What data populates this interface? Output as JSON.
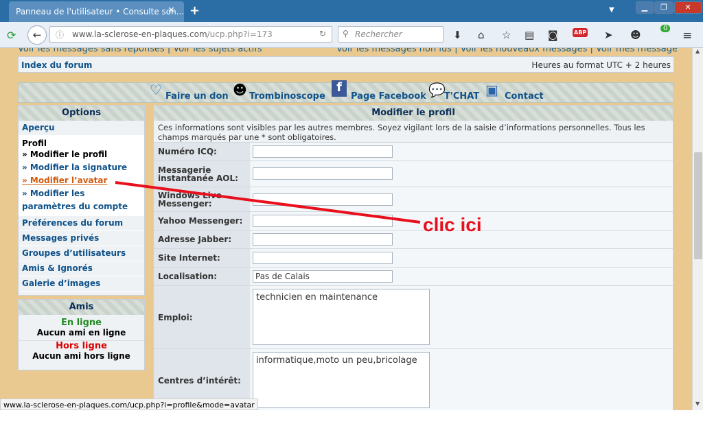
{
  "browser": {
    "tab_title": "Panneau de l'utilisateur • Consulte son...",
    "url_host": "www.la-sclerose-en-plaques.com",
    "url_path": "/ucp.php?i=173",
    "search_placeholder": "Rechercher",
    "abp_label": "ABP",
    "badge_count": "0",
    "status_url": "www.la-sclerose-en-plaques.com/ucp.php?i=profile&mode=avatar"
  },
  "forum": {
    "top_links_left": "Voir les messages sans réponses | Voir les sujets actifs",
    "top_links_right": "Voir les messages non lus | Voir les nouveaux messages | Voir mes messages",
    "index_link": "Index du forum",
    "timezone": "Heures au format UTC + 2 heures",
    "icon_links": [
      "Faire un don",
      "Trombinoscope",
      "Page Facebook",
      "T'CHAT",
      "Contact"
    ]
  },
  "sidebar": {
    "options_title": "Options",
    "apercu": "Aperçu",
    "profil_title": "Profil",
    "profil_items": [
      "» Modifier le profil",
      "» Modifier la signature",
      "» Modifier l’avatar",
      "» Modifier les paramètres du compte"
    ],
    "items": [
      "Préférences du forum",
      "Messages privés",
      "Groupes d’utilisateurs",
      "Amis & Ignorés",
      "Galerie d’images"
    ],
    "amis_title": "Amis",
    "online_label": "En ligne",
    "online_none": "Aucun ami en ligne",
    "offline_label": "Hors ligne",
    "offline_none": "Aucun ami hors ligne"
  },
  "form": {
    "title": "Modifier le profil",
    "info": "Ces informations sont visibles par les autres membres. Soyez vigilant lors de la saisie d’informations personnelles. Tous les champs marqués par une * sont obligatoires.",
    "fields": [
      {
        "label": "Numéro ICQ:",
        "value": ""
      },
      {
        "label": "Messagerie instantanée AOL:",
        "value": ""
      },
      {
        "label": "Windows Live Messenger:",
        "value": ""
      },
      {
        "label": "Yahoo Messenger:",
        "value": ""
      },
      {
        "label": "Adresse Jabber:",
        "value": ""
      },
      {
        "label": "Site Internet:",
        "value": ""
      },
      {
        "label": "Localisation:",
        "value": "Pas de Calais"
      },
      {
        "label": "Emploi:",
        "value": "technicien en maintenance"
      },
      {
        "label": "Centres d’intérêt:",
        "value": "informatique,moto un peu,bricolage"
      }
    ]
  },
  "annotation": {
    "text": "clic ici",
    "color": "#e8101c"
  }
}
